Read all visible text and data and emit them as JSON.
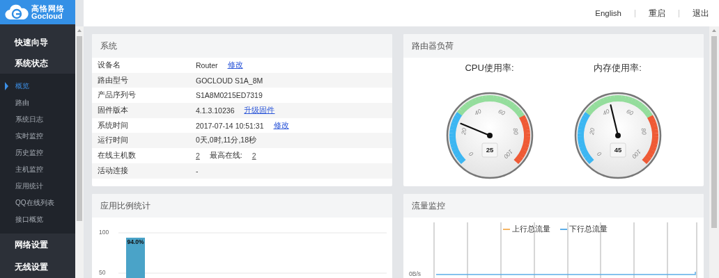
{
  "sidebar": {
    "logo": {
      "name": "高恪网络",
      "sub": "Gocloud"
    },
    "items": [
      {
        "label": "快速向导"
      },
      {
        "label": "系统状态",
        "children": [
          {
            "label": "概览",
            "selected": true
          },
          {
            "label": "路由",
            "selected": false
          },
          {
            "label": "系统日志",
            "selected": false
          },
          {
            "label": "实时监控",
            "selected": false
          },
          {
            "label": "历史监控",
            "selected": false
          },
          {
            "label": "主机监控",
            "selected": false
          },
          {
            "label": "应用统计",
            "selected": false
          },
          {
            "label": "QQ在线列表",
            "selected": false
          },
          {
            "label": "接口概览",
            "selected": false
          }
        ]
      },
      {
        "label": "网络设置"
      },
      {
        "label": "无线设置"
      }
    ]
  },
  "header": {
    "links": [
      "English",
      "重启",
      "退出"
    ]
  },
  "system": {
    "title": "系统",
    "rows": [
      {
        "label": "设备名",
        "value": "Router",
        "kind": "text",
        "link": "修改"
      },
      {
        "label": "路由型号",
        "value": "GOCLOUD S1A_8M",
        "kind": "text"
      },
      {
        "label": "产品序列号",
        "value": "S1A8M0215ED7319",
        "kind": "text"
      },
      {
        "label": "固件版本",
        "value": "4.1.3.10236",
        "kind": "text",
        "link": "升级固件"
      },
      {
        "label": "系统时间",
        "value": "2017-07-14 10:51:31",
        "kind": "text",
        "link": "修改"
      },
      {
        "label": "运行时间",
        "value": "0天,0时,11分,18秒",
        "kind": "text"
      },
      {
        "label": "在线主机数",
        "value": "2",
        "kind": "count",
        "extra": {
          "label": "最高在线:",
          "value": "2"
        }
      },
      {
        "label": "活动连接",
        "value": "-",
        "kind": "text"
      }
    ]
  },
  "load": {
    "title": "路由器负荷",
    "gauges": [
      {
        "title": "CPU使用率:",
        "level": 0.25,
        "reading": "25",
        "scale": [
          "0",
          "20",
          "40",
          "60",
          "80",
          "100"
        ]
      },
      {
        "title": "内存使用率:",
        "level": 0.45,
        "reading": "45",
        "scale": [
          "0",
          "20",
          "40",
          "60",
          "80",
          "100"
        ]
      }
    ]
  },
  "apps": {
    "title": "应用比例统计",
    "axis_labels": [
      "100",
      "50"
    ],
    "bar_labels": [
      "94.0%"
    ]
  },
  "traffic": {
    "title": "流量监控",
    "axis_label": "0B/s",
    "legend": [
      {
        "name": "上行总流量",
        "color": "#f5b563"
      },
      {
        "name": "下行总流量",
        "color": "#5eaee8"
      }
    ]
  }
}
